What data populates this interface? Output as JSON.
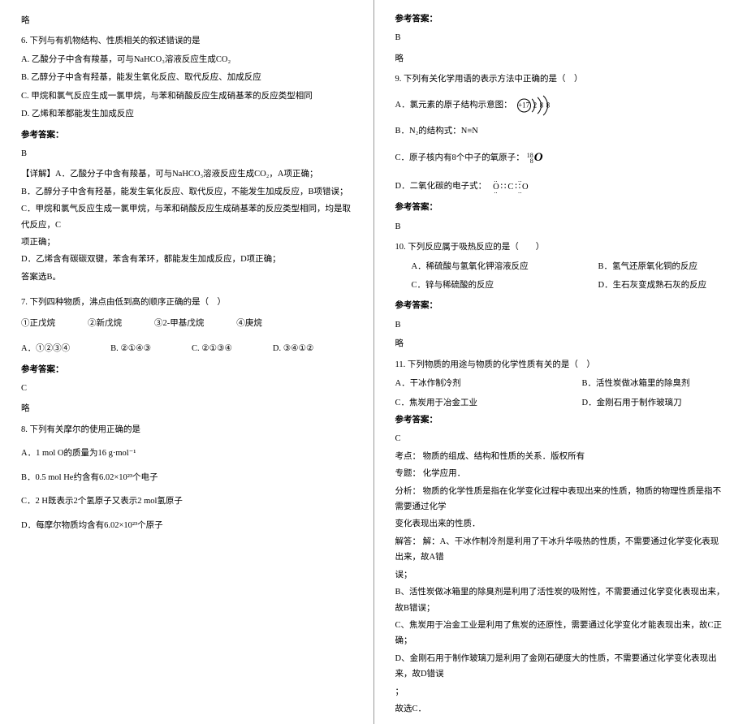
{
  "left": {
    "lue1": "略",
    "q6": {
      "stem": "6. 下列与有机物结构、性质相关的叙述错误的是",
      "A": "A. 乙酸分子中含有羧基，可与NaHCO₃溶液反应生成CO₂",
      "B": "B. 乙醇分子中含有羟基，能发生氧化反应、取代反应、加成反应",
      "C": "C. 甲烷和氯气反应生成一氯甲烷，与苯和硝酸反应生成硝基苯的反应类型相同",
      "D": "D. 乙烯和苯都能发生加成反应",
      "ansHeader": "参考答案：",
      "ansLetter": "B",
      "explainLabel": "【详解】A．乙酸分子中含有羧基，可与NaHCO₃溶液反应生成CO₂，A项正确；",
      "explainB": "B．乙醇分子中含有羟基，能发生氧化反应、取代反应，不能发生加成反应，B项错误；",
      "explainC1": "C．甲烷和氯气反应生成一氯甲烷，与苯和硝酸反应生成硝基苯的反应类型相同，均是取代反应，C",
      "explainC2": "项正确；",
      "explainD": "D．乙烯含有碳碳双键，苯含有苯环，都能发生加成反应，D项正确；",
      "explainEnd": "答案选B。"
    },
    "q7": {
      "stem": "7. 下列四种物质，沸点由低到高的顺序正确的是（　）",
      "items1": "①正戊烷",
      "items2": "②新戊烷",
      "items3": "③2-甲基戊烷",
      "items4": "④庚烷",
      "A": "A．①②③④",
      "B": "B. ②①④③",
      "C": "C. ②①③④",
      "D": "D. ③④①②",
      "ansHeader": "参考答案：",
      "ansLetter": "C",
      "lue": "略"
    },
    "q8": {
      "stem": "8. 下列有关摩尔的使用正确的是",
      "A": "A．1 mol O的质量为16 g·mol⁻¹",
      "B": "B．0.5 mol He约含有6.02×10²³个电子",
      "C": "C．2 H既表示2个氢原子又表示2 mol氢原子",
      "D": "D．每摩尔物质均含有6.02×10²³个原子"
    }
  },
  "right": {
    "ansHeader1": "参考答案：",
    "ansLetter1": "B",
    "lue1": "略",
    "q9": {
      "stem": "9. 下列有关化学用语的表示方法中正确的是（　）",
      "A": "A．氯元素的原子结构示意图：",
      "core": "+17",
      "n1": "2",
      "n2": "8",
      "n3": "8",
      "Bpre": "B．N₂的结构式：N≡N",
      "Cpre": "C．原子核内有8个中子的氧原子：",
      "iso_top": "18",
      "iso_bot": "8",
      "iso_O": "O",
      "Dpre": "D．二氧化碳的电子式：",
      "lewis": "O∷C∷O",
      "ansHeader": "参考答案：",
      "ansLetter": "B"
    },
    "q10": {
      "stem": "10. 下列反应属于吸热反应的是（　　）",
      "A": "A．稀硫酸与氢氧化钾溶液反应",
      "B": "B．氢气还原氧化铜的反应",
      "C": "C．锌与稀硫酸的反应",
      "D": "D．生石灰变成熟石灰的反应",
      "ansHeader": "参考答案：",
      "ansLetter": "B",
      "lue": "略"
    },
    "q11": {
      "stem": "11. 下列物质的用途与物质的化学性质有关的是（　）",
      "A": "A．干冰作制冷剂",
      "B": "B．活性炭做冰箱里的除臭剂",
      "C": "C．焦炭用于冶金工业",
      "D": "D．金刚石用于制作玻璃刀",
      "ansHeader": "参考答案：",
      "ansLetter": "C",
      "kd": "考点：  物质的组成、结构和性质的关系．版权所有",
      "zt": "专题：  化学应用．",
      "fx1": "分析：  物质的化学性质是指在化学变化过程中表现出来的性质，物质的物理性质是指不需要通过化学",
      "fx2": "变化表现出来的性质．",
      "jdA1": "解答：  解：A、干冰作制冷剂是利用了干冰升华吸热的性质，不需要通过化学变化表现出来，故A错",
      "jdA2": "误；",
      "jdB": "B、活性炭做冰箱里的除臭剂是利用了活性炭的吸附性，不需要通过化学变化表现出来，故B错误；",
      "jdC": "C、焦炭用于冶金工业是利用了焦炭的还原性，需要通过化学变化才能表现出来，故C正确；",
      "jdD1": "D、金刚石用于制作玻璃刀是利用了金刚石硬度大的性质，不需要通过化学变化表现出来，故D错误",
      "jdD2": "；",
      "jdEnd": "故选C．"
    }
  }
}
